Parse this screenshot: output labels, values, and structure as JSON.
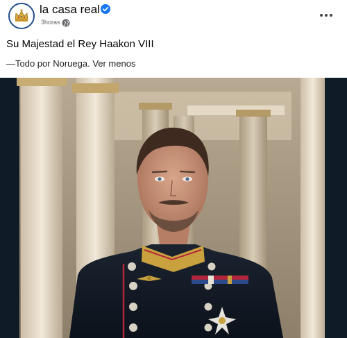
{
  "post": {
    "page_name": "la casa real",
    "time_ago": "3horas",
    "title": "Su Majestad el Rey Haakon VIII",
    "caption": "—Todo por Noruega.",
    "see_less": "Ver menos"
  },
  "icons": {
    "avatar": "crown-logo",
    "verified": "verified-badge-icon",
    "audience": "globe-icon",
    "more": "more-options-icon"
  },
  "colors": {
    "verified_blue": "#1877f2",
    "avatar_ring": "#1f4a8a",
    "uniform": "#101722",
    "collar_gold": "#c9a23f",
    "piping_red": "#b3263a"
  }
}
